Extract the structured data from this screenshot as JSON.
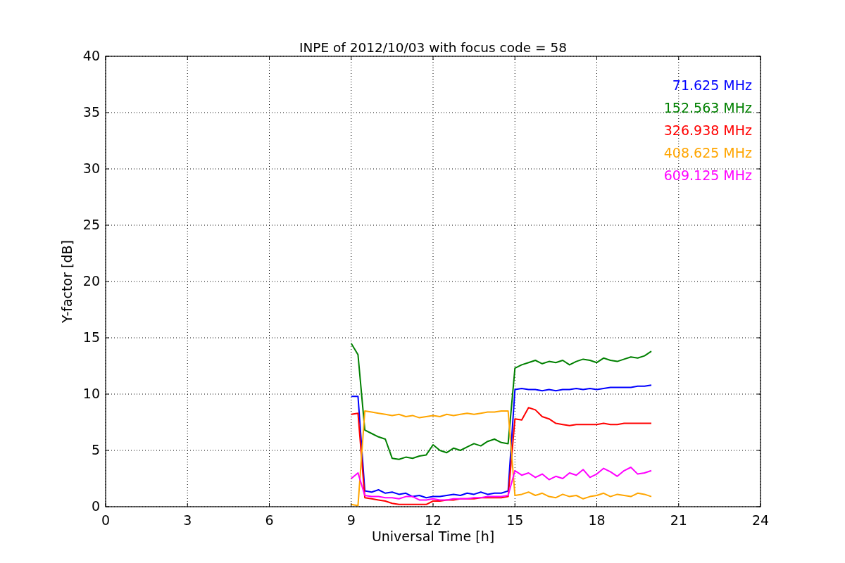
{
  "chart_data": {
    "type": "line",
    "title": "INPE of 2012/10/03 with focus code = 58",
    "xlabel": "Universal Time [h]",
    "ylabel": "Y-factor [dB]",
    "x": [
      9,
      9.25,
      9.5,
      9.75,
      10,
      10.25,
      10.5,
      10.75,
      11,
      11.25,
      11.5,
      11.75,
      12,
      12.25,
      12.5,
      12.75,
      13,
      13.25,
      13.5,
      13.75,
      14,
      14.25,
      14.5,
      14.75,
      15,
      15.25,
      15.5,
      15.75,
      16,
      16.25,
      16.5,
      16.75,
      17,
      17.25,
      17.5,
      17.75,
      18,
      18.25,
      18.5,
      18.75,
      19,
      19.25,
      19.5,
      19.75,
      20
    ],
    "grid": true,
    "xlim": [
      0,
      24
    ],
    "ylim": [
      0,
      40
    ],
    "xticks": [
      0,
      3,
      6,
      9,
      12,
      15,
      18,
      21,
      24
    ],
    "yticks": [
      0,
      5,
      10,
      15,
      20,
      25,
      30,
      35,
      40
    ],
    "series": [
      {
        "name": "71.625 MHz",
        "color": "#0000ff",
        "values": [
          9.8,
          9.8,
          1.4,
          1.3,
          1.5,
          1.2,
          1.3,
          1.1,
          1.2,
          0.9,
          1.0,
          0.8,
          0.9,
          0.9,
          1.0,
          1.1,
          1.0,
          1.2,
          1.1,
          1.3,
          1.1,
          1.2,
          1.2,
          1.4,
          10.4,
          10.5,
          10.4,
          10.4,
          10.3,
          10.4,
          10.3,
          10.4,
          10.4,
          10.5,
          10.4,
          10.5,
          10.4,
          10.5,
          10.6,
          10.6,
          10.6,
          10.6,
          10.7,
          10.7,
          10.8
        ]
      },
      {
        "name": "152.563 MHz",
        "color": "#008000",
        "values": [
          14.5,
          13.5,
          6.8,
          6.5,
          6.2,
          6.0,
          4.3,
          4.2,
          4.4,
          4.3,
          4.5,
          4.6,
          5.5,
          5.0,
          4.8,
          5.2,
          5.0,
          5.3,
          5.6,
          5.4,
          5.8,
          6.0,
          5.7,
          5.6,
          12.3,
          12.6,
          12.8,
          13.0,
          12.7,
          12.9,
          12.8,
          13.0,
          12.6,
          12.9,
          13.1,
          13.0,
          12.8,
          13.2,
          13.0,
          12.9,
          13.1,
          13.3,
          13.2,
          13.4,
          13.8
        ]
      },
      {
        "name": "326.938 MHz",
        "color": "#ff0000",
        "values": [
          8.2,
          8.3,
          0.8,
          0.7,
          0.6,
          0.5,
          0.3,
          0.2,
          0.2,
          0.2,
          0.2,
          0.2,
          0.5,
          0.5,
          0.6,
          0.6,
          0.7,
          0.7,
          0.7,
          0.8,
          0.8,
          0.8,
          0.8,
          0.9,
          7.8,
          7.7,
          8.8,
          8.6,
          8.0,
          7.8,
          7.4,
          7.3,
          7.2,
          7.3,
          7.3,
          7.3,
          7.3,
          7.4,
          7.3,
          7.3,
          7.4,
          7.4,
          7.4,
          7.4,
          7.4
        ]
      },
      {
        "name": "408.625 MHz",
        "color": "#ffa500",
        "values": [
          0.2,
          0.1,
          8.5,
          8.4,
          8.3,
          8.2,
          8.1,
          8.2,
          8.0,
          8.1,
          7.9,
          8.0,
          8.1,
          8.0,
          8.2,
          8.1,
          8.2,
          8.3,
          8.2,
          8.3,
          8.4,
          8.4,
          8.5,
          8.5,
          1.0,
          1.1,
          1.3,
          1.0,
          1.2,
          0.9,
          0.8,
          1.1,
          0.9,
          1.0,
          0.7,
          0.9,
          1.0,
          1.2,
          0.9,
          1.1,
          1.0,
          0.9,
          1.2,
          1.1,
          0.9
        ]
      },
      {
        "name": "609.125 MHz",
        "color": "#ff00ff",
        "values": [
          2.5,
          3.0,
          1.0,
          0.9,
          0.9,
          0.8,
          0.8,
          0.7,
          0.9,
          0.9,
          0.6,
          0.6,
          0.7,
          0.6,
          0.6,
          0.7,
          0.7,
          0.7,
          0.8,
          0.8,
          0.9,
          0.9,
          0.9,
          1.0,
          3.2,
          2.8,
          3.0,
          2.6,
          2.9,
          2.4,
          2.7,
          2.5,
          3.0,
          2.8,
          3.3,
          2.6,
          2.9,
          3.4,
          3.1,
          2.7,
          3.2,
          3.5,
          2.9,
          3.0,
          3.2
        ]
      }
    ]
  }
}
